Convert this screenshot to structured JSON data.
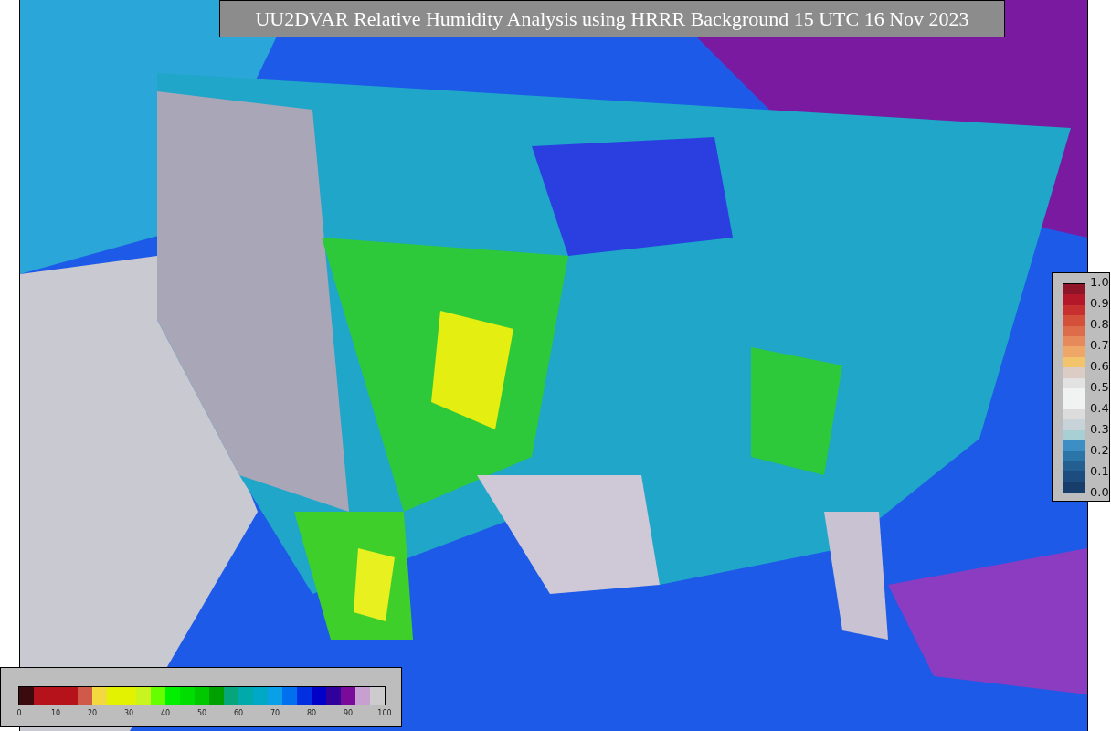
{
  "title": "UU2DVAR Relative Humidity Analysis using HRRR Background 15 UTC 16 Nov 2023",
  "side_colorbar": {
    "ticks": [
      "1.0",
      "0.9",
      "0.8",
      "0.7",
      "0.6",
      "0.5",
      "0.4",
      "0.3",
      "0.2",
      "0.1",
      "0.0"
    ],
    "segments": [
      {
        "color": "#8e1428"
      },
      {
        "color": "#b5172a"
      },
      {
        "color": "#c8302f"
      },
      {
        "color": "#d4503a"
      },
      {
        "color": "#dd6c4a"
      },
      {
        "color": "#e6895b"
      },
      {
        "color": "#eea766"
      },
      {
        "color": "#f4c46d"
      },
      {
        "color": "#dcccc6"
      },
      {
        "color": "#e2e2e2"
      },
      {
        "color": "#f1f2f2"
      },
      {
        "color": "#f1f2f2"
      },
      {
        "color": "#dcdcdc"
      },
      {
        "color": "#c8d3d9"
      },
      {
        "color": "#a7cfd4"
      },
      {
        "color": "#3d8ec4"
      },
      {
        "color": "#2c75a8"
      },
      {
        "color": "#245f92"
      },
      {
        "color": "#1d4c7e"
      },
      {
        "color": "#173d6a"
      }
    ]
  },
  "bottom_colorbar": {
    "ticks": [
      "0",
      "10",
      "20",
      "30",
      "40",
      "50",
      "60",
      "70",
      "80",
      "90",
      "100"
    ],
    "segments": [
      {
        "color": "#3a0a0e"
      },
      {
        "color": "#b5121b"
      },
      {
        "color": "#b5121b"
      },
      {
        "color": "#b5121b"
      },
      {
        "color": "#cf5a4a"
      },
      {
        "color": "#f3d93f"
      },
      {
        "color": "#e2f200"
      },
      {
        "color": "#e2f200"
      },
      {
        "color": "#c8f520"
      },
      {
        "color": "#66ff00"
      },
      {
        "color": "#00f000"
      },
      {
        "color": "#00dd00"
      },
      {
        "color": "#00c800"
      },
      {
        "color": "#00a000"
      },
      {
        "color": "#06a67a"
      },
      {
        "color": "#00aaaa"
      },
      {
        "color": "#00a8c8"
      },
      {
        "color": "#0aa0e8"
      },
      {
        "color": "#0070f0"
      },
      {
        "color": "#0030e0"
      },
      {
        "color": "#0000c8"
      },
      {
        "color": "#30009a"
      },
      {
        "color": "#7a0a9a"
      },
      {
        "color": "#c8a0d0"
      },
      {
        "color": "#cccccc"
      }
    ]
  }
}
